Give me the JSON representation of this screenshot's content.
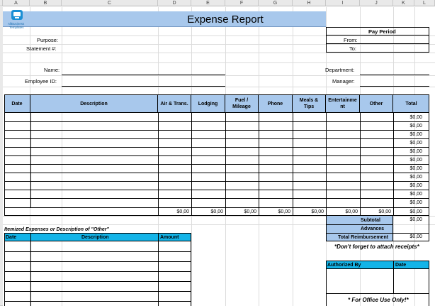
{
  "title": "Expense Report",
  "logo": {
    "line1": "AllBusiness",
    "line2": "Templates",
    "icon": "allbusiness-logo-icon"
  },
  "columns": [
    "A",
    "B",
    "C",
    "D",
    "E",
    "F",
    "G",
    "H",
    "I",
    "J",
    "K",
    "L"
  ],
  "labels": {
    "purpose": "Purpose:",
    "statement": "Statement #:",
    "name": "Name:",
    "employee_id": "Employee ID:",
    "pay_period": "Pay Period",
    "from": "From:",
    "to": "To:",
    "department": "Department:",
    "manager": "Manager:"
  },
  "table_headers": {
    "date": "Date",
    "description": "Description",
    "air": "Air & Trans.",
    "lodging": "Lodging",
    "fuel1": "Fuel /",
    "fuel2": "Mileage",
    "phone": "Phone",
    "meals1": "Meals &",
    "meals2": "Tips",
    "ent1": "Entertainme",
    "ent2": "nt",
    "other": "Other",
    "total": "Total"
  },
  "row_totals": [
    "$0,00",
    "$0,00",
    "$0,00",
    "$0,00",
    "$0,00",
    "$0,00",
    "$0,00",
    "$0,00",
    "$0,00",
    "$0,00",
    "$0,00",
    "$0,00"
  ],
  "column_totals": {
    "air": "$0,00",
    "lodging": "$0,00",
    "fuel": "$0,00",
    "phone": "$0,00",
    "meals": "$0,00",
    "ent": "$0,00",
    "other": "$0,00"
  },
  "summary": {
    "subtotal_label": "Subtotal",
    "subtotal_value": "$0,00",
    "advances_label": "Advances",
    "reimb_label": "Total Reimbursement",
    "reimb_value": "$0,00",
    "receipts_note": "*Don't forget to attach receipts*"
  },
  "itemized": {
    "title": "Itemized Expenses or Description of \"Other\"",
    "date": "Date",
    "description": "Description",
    "amount": "Amount"
  },
  "approval": {
    "authorized_by": "Authorized By",
    "date": "Date",
    "office_note": "* For Office Use Only!*"
  },
  "colors": {
    "header_blue": "#a8c8ec",
    "accent_cyan": "#13b4e8"
  }
}
